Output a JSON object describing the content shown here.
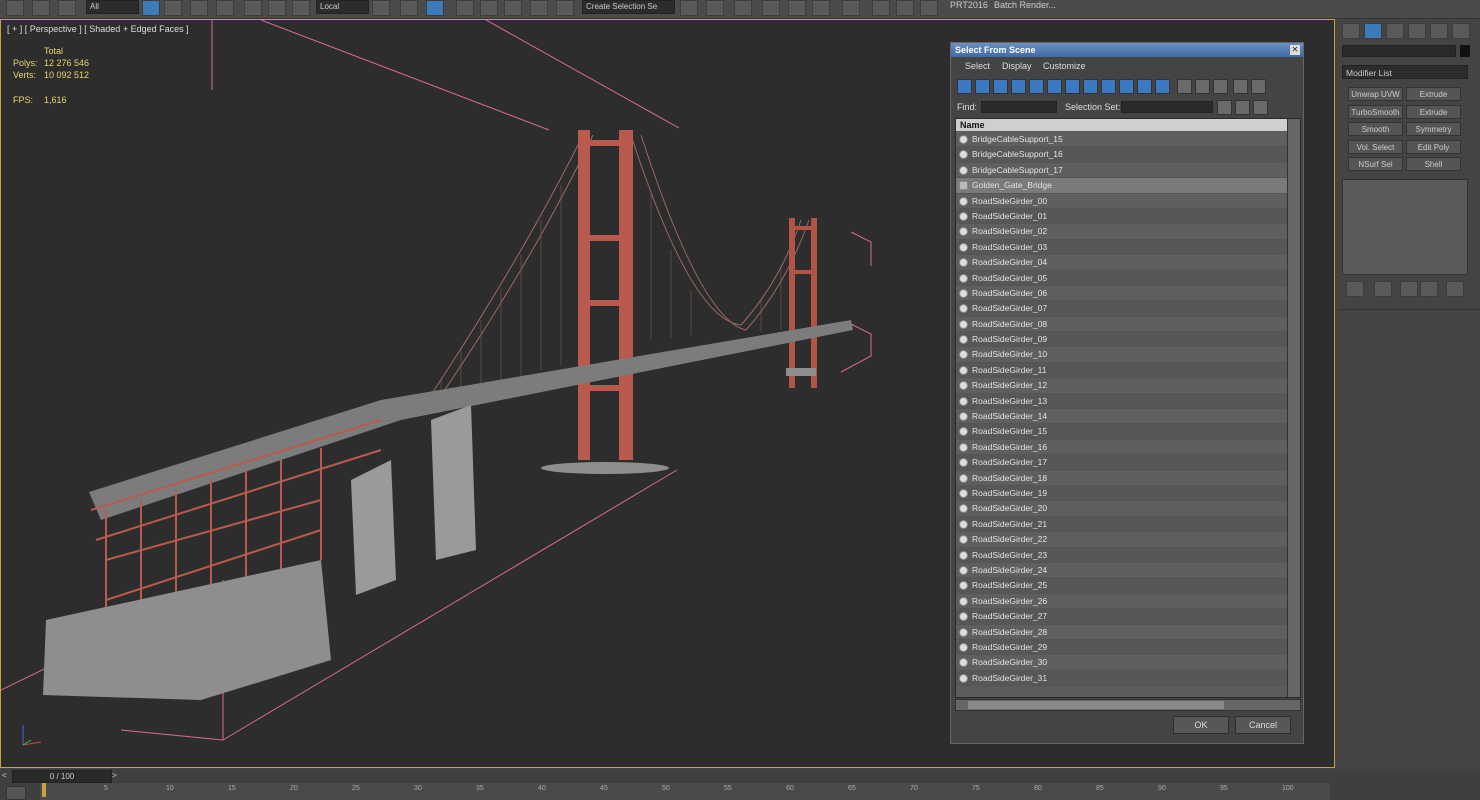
{
  "toolbar": {
    "filter_combo": "All",
    "coord_combo": "Local",
    "selection_set_combo": "Create Selection Se",
    "prt_label": "PRT2016",
    "batch_render_label": "Batch Render..."
  },
  "viewport": {
    "label": "[ + ] [ Perspective ] [ Shaded + Edged Faces ]",
    "stats": {
      "total_label": "Total",
      "polys_label": "Polys:",
      "polys_value": "12 276 546",
      "verts_label": "Verts:",
      "verts_value": "10 092 512",
      "fps_label": "FPS:",
      "fps_value": "1,616"
    }
  },
  "dialog": {
    "title": "Select From Scene",
    "menu": [
      "Select",
      "Display",
      "Customize"
    ],
    "find_label": "Find:",
    "selection_set_label": "Selection Set:",
    "column_header": "Name",
    "rows": [
      "BridgeCableSupport_15",
      "BridgeCableSupport_16",
      "BridgeCableSupport_17",
      "Golden_Gate_Bridge",
      "RoadSideGirder_00",
      "RoadSideGirder_01",
      "RoadSideGirder_02",
      "RoadSideGirder_03",
      "RoadSideGirder_04",
      "RoadSideGirder_05",
      "RoadSideGirder_06",
      "RoadSideGirder_07",
      "RoadSideGirder_08",
      "RoadSideGirder_09",
      "RoadSideGirder_10",
      "RoadSideGirder_11",
      "RoadSideGirder_12",
      "RoadSideGirder_13",
      "RoadSideGirder_14",
      "RoadSideGirder_15",
      "RoadSideGirder_16",
      "RoadSideGirder_17",
      "RoadSideGirder_18",
      "RoadSideGirder_19",
      "RoadSideGirder_20",
      "RoadSideGirder_21",
      "RoadSideGirder_22",
      "RoadSideGirder_23",
      "RoadSideGirder_24",
      "RoadSideGirder_25",
      "RoadSideGirder_26",
      "RoadSideGirder_27",
      "RoadSideGirder_28",
      "RoadSideGirder_29",
      "RoadSideGirder_30",
      "RoadSideGirder_31"
    ],
    "selected_row": "Golden_Gate_Bridge",
    "ok_label": "OK",
    "cancel_label": "Cancel"
  },
  "modify_panel": {
    "modifier_list": "Modifier List",
    "buttons": [
      "Unwrap UVW",
      "Extrude",
      "TurboSmooth",
      "Extrude",
      "Smooth",
      "Symmetry",
      "Vol. Select",
      "Edit Poly",
      "NSurf Sel",
      "Shell"
    ]
  },
  "timeline": {
    "slider_text": "0 / 100",
    "ticks": [
      "5",
      "10",
      "15",
      "20",
      "25",
      "30",
      "35",
      "40",
      "45",
      "50",
      "55",
      "60",
      "65",
      "70",
      "75",
      "80",
      "85",
      "90",
      "95",
      "100"
    ]
  },
  "colors": {
    "viewport_bg": "#2d2d2d",
    "viewport_border": "#c8a23c",
    "stats_text": "#e8d56a",
    "title_bar": "#3f6aa6",
    "bridge_red": "#b85a4e",
    "concrete": "#8e8e8e",
    "bounding_box": "#d86c8c"
  }
}
